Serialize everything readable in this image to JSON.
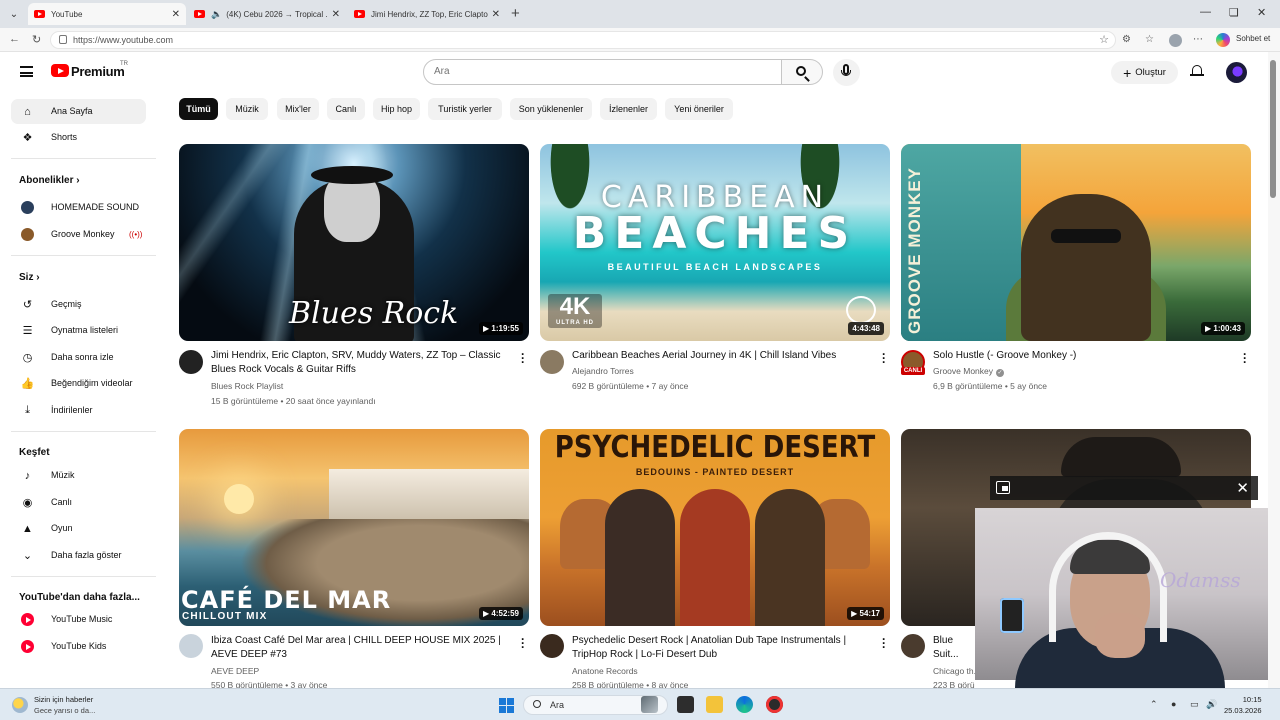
{
  "browser": {
    "tabs": [
      {
        "title": "YouTube",
        "active": true
      },
      {
        "title": "(4K) Cebu 2026 → Tropical ...",
        "active": false
      },
      {
        "title": "Jimi Hendrix, ZZ Top, Eric Clapton, ...",
        "active": false
      }
    ],
    "url": "https://www.youtube.com",
    "copilot_label": "Sohbet et"
  },
  "header": {
    "logo_text": "Premium",
    "logo_region": "TR",
    "search_placeholder": "Ara",
    "create_label": "Oluştur"
  },
  "sidebar": {
    "main": [
      {
        "label": "Ana Sayfa",
        "icon": "home-icon"
      },
      {
        "label": "Shorts",
        "icon": "shorts-icon"
      }
    ],
    "subscriptions_heading": "Abonelikler",
    "subscriptions": [
      {
        "label": "HOMEMADE SOUND",
        "color": "#2a3f5c"
      },
      {
        "label": "Groove Monkey",
        "color": "#8a5a2a",
        "live": "((•))"
      }
    ],
    "you_heading": "Siz",
    "you": [
      {
        "label": "Geçmiş",
        "icon": "history-icon"
      },
      {
        "label": "Oynatma listeleri",
        "icon": "playlists-icon"
      },
      {
        "label": "Daha sonra izle",
        "icon": "watch-later-icon"
      },
      {
        "label": "Beğendiğim videolar",
        "icon": "thumbs-up-icon"
      },
      {
        "label": "İndirilenler",
        "icon": "download-icon"
      }
    ],
    "explore_heading": "Keşfet",
    "explore": [
      {
        "label": "Müzik",
        "icon": "music-icon"
      },
      {
        "label": "Canlı",
        "icon": "live-icon"
      },
      {
        "label": "Oyun",
        "icon": "gaming-icon"
      },
      {
        "label": "Daha fazla göster",
        "icon": "chevron-down-icon"
      }
    ],
    "more_heading": "YouTube'dan daha fazla...",
    "more": [
      {
        "label": "YouTube Music"
      },
      {
        "label": "YouTube Kids"
      }
    ]
  },
  "chips": [
    "Tümü",
    "Müzik",
    "Mix'ler",
    "Canlı",
    "Hip hop",
    "Turistik yerler",
    "Son yüklenenler",
    "İzlenenler",
    "Yeni öneriler"
  ],
  "videos": [
    {
      "title": "Jimi Hendrix, Eric Clapton, SRV, Muddy Waters, ZZ Top – Classic Blues Rock Vocals & Guitar Riffs",
      "channel": "Blues Rock Playlist",
      "meta": "15 B görüntüleme • 20 saat önce yayınlandı",
      "duration": "▶ 1:19:55",
      "thumb_text": "Blues Rock"
    },
    {
      "title": "Caribbean Beaches Aerial Journey in 4K | Chill Island Vibes",
      "channel": "Alejandro Torres",
      "meta": "692 B görüntüleme • 7 ay önce",
      "duration": "4:43:48",
      "thumb_text_1": "CARIBBEAN",
      "thumb_text_2": "BEACHES",
      "thumb_text_3": "BEAUTIFUL BEACH LANDSCAPES",
      "thumb_badge": "4K",
      "thumb_badge_sub": "ULTRA HD"
    },
    {
      "title": "Solo Hustle (- Groove Monkey -)",
      "channel": "Groove Monkey",
      "verified": "✓",
      "meta": "6,9 B görüntüleme • 5 ay önce",
      "duration": "▶ 1:00:43",
      "thumb_text": "GROOVE MONKEY",
      "live_badge": "CANLI"
    },
    {
      "title": "Ibiza Coast Café Del Mar area | CHILL DEEP HOUSE MIX 2025 | AEVE DEEP #73",
      "channel": "AEVE DEEP",
      "meta": "550 B görüntüleme • 3 ay önce",
      "duration": "▶ 4:52:59",
      "thumb_text_1": "CAFÉ DEL MAR",
      "thumb_text_2": "CHILLOUT MIX"
    },
    {
      "title": "Psychedelic Desert Rock | Anatolian Dub Tape Instrumentals | TripHop Rock | Lo-Fi Desert Dub",
      "channel": "Anatone Records",
      "meta": "258 B görüntüleme • 8 ay önce",
      "duration": "▶ 54:17",
      "thumb_text_1": "PSYCHEDELIC DESERT",
      "thumb_text_2": "BEDOUINS - PAINTED DESERT"
    },
    {
      "title": "Blue Suit... Tranquil ...",
      "channel": "Chicago th...",
      "meta": "223 B görüntüleme • 2 ay önce"
    }
  ],
  "webcam": {
    "logo_text": "Odamss"
  },
  "taskbar": {
    "news_line1": "Sizin için haberler",
    "news_line2": "Gece yarısı o da...",
    "search_label": "Ara",
    "time": "10:15",
    "date": "25.03.2026"
  }
}
